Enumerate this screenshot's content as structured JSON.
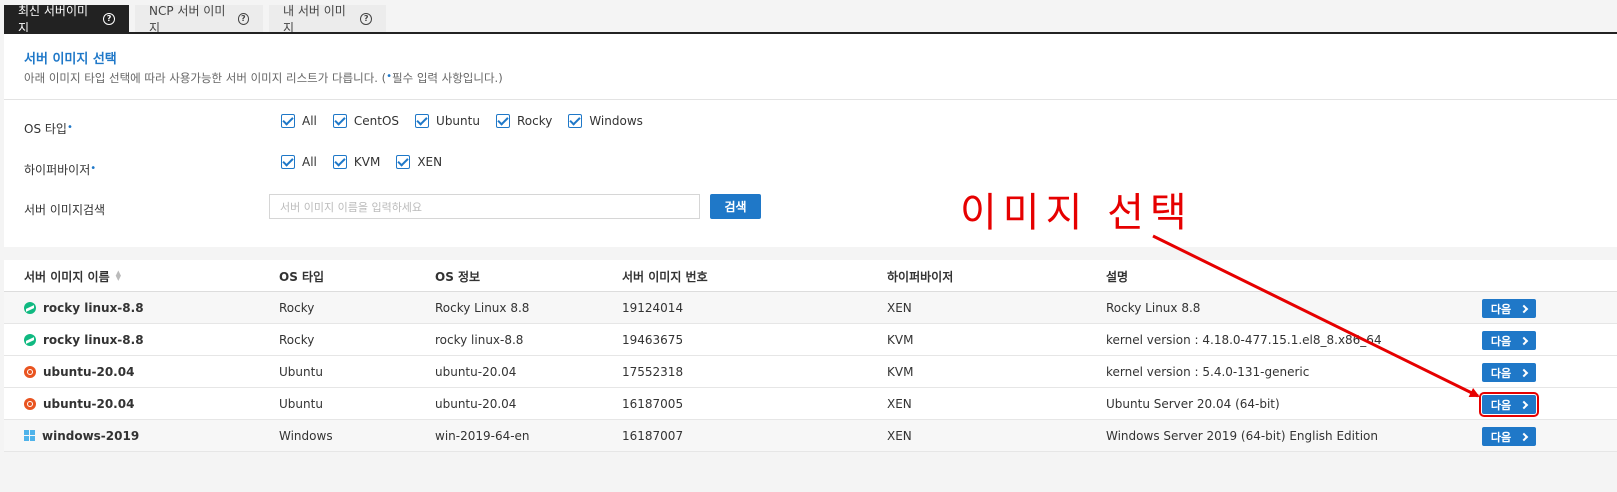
{
  "tabs": [
    {
      "label": "최신 서버이미지",
      "active": true
    },
    {
      "label": "NCP 서버 이미지",
      "active": false
    },
    {
      "label": "내 서버 이미지",
      "active": false
    }
  ],
  "panel": {
    "title": "서버 이미지 선택",
    "desc_before": "아래 이미지 타입 선택에 따라 사용가능한 서버 이미지 리스트가 다릅니다. (",
    "req_dot": "•",
    "desc_after": "필수 입력 사항입니다.)"
  },
  "os_type": {
    "label": "OS 타입",
    "options": [
      "All",
      "CentOS",
      "Ubuntu",
      "Rocky",
      "Windows"
    ]
  },
  "hypervisor": {
    "label": "하이퍼바이저",
    "options": [
      "All",
      "KVM",
      "XEN"
    ]
  },
  "search": {
    "label": "서버 이미지검색",
    "placeholder": "서버 이미지 이름을 입력하세요",
    "button": "검색"
  },
  "annotation": {
    "text": "이미지 선택",
    "color": "#e60000"
  },
  "table": {
    "headers": [
      "서버 이미지 이름",
      "OS 타입",
      "OS 정보",
      "서버 이미지 번호",
      "하이퍼바이저",
      "설명"
    ],
    "next_label": "다음",
    "rows": [
      {
        "icon": "rocky-icon",
        "name": "rocky linux-8.8",
        "os_type": "Rocky",
        "os_info": "Rocky Linux 8.8",
        "image_no": "19124014",
        "hypervisor": "XEN",
        "desc": "Rocky Linux 8.8"
      },
      {
        "icon": "rocky-icon",
        "name": "rocky linux-8.8",
        "os_type": "Rocky",
        "os_info": "rocky linux-8.8",
        "image_no": "19463675",
        "hypervisor": "KVM",
        "desc": "kernel version : 4.18.0-477.15.1.el8_8.x86_64"
      },
      {
        "icon": "ubuntu-icon",
        "name": "ubuntu-20.04",
        "os_type": "Ubuntu",
        "os_info": "ubuntu-20.04",
        "image_no": "17552318",
        "hypervisor": "KVM",
        "desc": "kernel version : 5.4.0-131-generic"
      },
      {
        "icon": "ubuntu-icon",
        "name": "ubuntu-20.04",
        "os_type": "Ubuntu",
        "os_info": "ubuntu-20.04",
        "image_no": "16187005",
        "hypervisor": "XEN",
        "desc": "Ubuntu Server 20.04 (64-bit)"
      },
      {
        "icon": "windows-icon",
        "name": "windows-2019",
        "os_type": "Windows",
        "os_info": "win-2019-64-en",
        "image_no": "16187007",
        "hypervisor": "XEN",
        "desc": "Windows Server 2019 (64-bit) English Edition"
      }
    ]
  },
  "colors": {
    "accent": "#1f78c8",
    "annotation": "#e60000"
  }
}
